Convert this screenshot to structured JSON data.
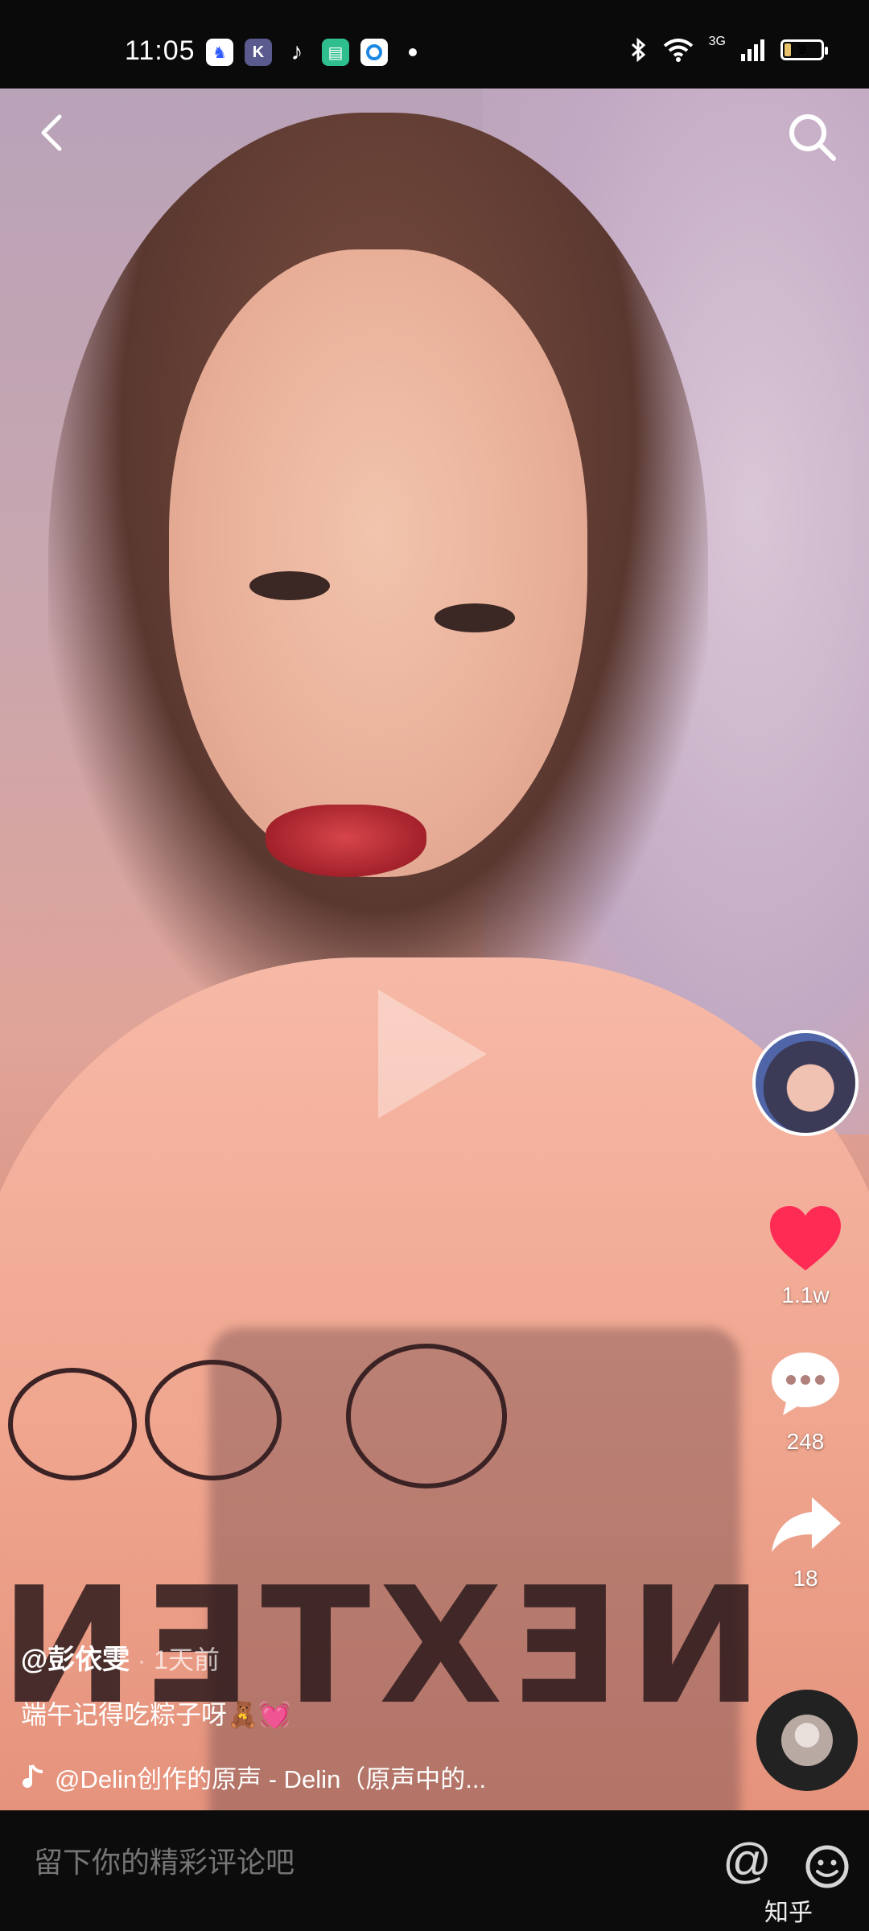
{
  "status_bar": {
    "time": "11:05",
    "network": "3G",
    "battery": "9",
    "apps": [
      "baidu",
      "k-app",
      "douyin",
      "green-app",
      "browser"
    ]
  },
  "video": {
    "author": "@彭依雯",
    "separator": "·",
    "time_ago": "1天前",
    "description": "端午记得吃粽子呀🧸💓",
    "music": "@Delin创作的原声 - Delin（原声中的...",
    "shirt_print": "NEXTEN"
  },
  "actions": {
    "likes": "1.1w",
    "comments": "248",
    "shares": "18"
  },
  "comment_bar": {
    "placeholder": "留下你的精彩评论吧",
    "at_symbol": "@"
  },
  "watermark": "知乎",
  "colors": {
    "like": "#fe2c55",
    "background": "#000000"
  }
}
